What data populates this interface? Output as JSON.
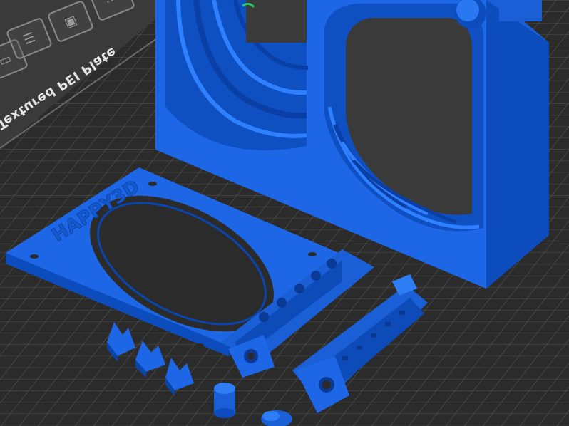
{
  "bed": {
    "plate_label": "Textured PEI Plate",
    "plate_color": "#2c2c2c",
    "grid_color": "#5e5e5e",
    "background": "#3a3a3a"
  },
  "model": {
    "color": "#1565e0",
    "color_dark": "#0b4fc4",
    "color_light": "#2f7df5",
    "engraved_text": "HAPPY3D"
  },
  "toolbar": {
    "icons": [
      "layers-icon",
      "list-icon",
      "image-icon",
      "more-icon"
    ]
  }
}
